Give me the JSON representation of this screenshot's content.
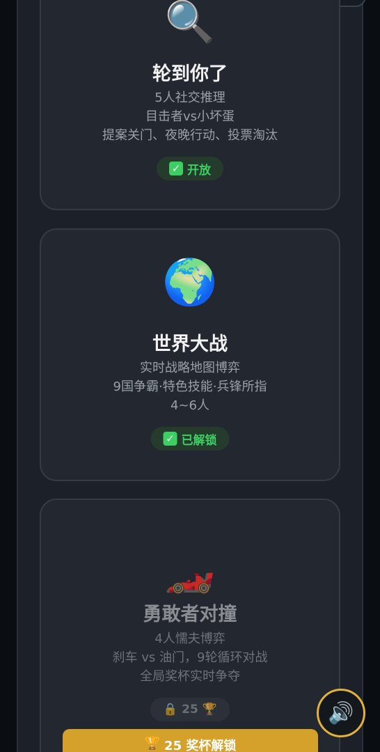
{
  "cards": [
    {
      "icon": "🔍",
      "icon_name": "magnifier-icon",
      "title": "轮到你了",
      "lines": [
        "5人社交推理",
        "目击者vs小坏蛋",
        "提案关门、夜晚行动、投票淘汰"
      ],
      "badge": "开放"
    },
    {
      "icon": "🌍",
      "icon_name": "globe-icon",
      "title": "世界大战",
      "lines": [
        "实时战略地图博弈",
        "9国争霸·特色技能·兵锋所指",
        "4~6人"
      ],
      "badge": "已解锁"
    },
    {
      "icon": "🏎️",
      "icon_name": "race-car-icon",
      "title": "勇敢者对撞",
      "lines": [
        "4人懦夫博弈",
        "刹车 vs 油门，9轮循环对战",
        "全局奖杯实时争夺"
      ],
      "badge_lock": "🔒",
      "badge_count": "25",
      "badge_trophy": "🏆"
    }
  ],
  "unlock_button": {
    "icon": "🏆",
    "label": "25 奖杯解锁"
  },
  "sound_button": {
    "icon": "🔊"
  },
  "colors": {
    "accent_gold": "#d6a12a",
    "status_green": "#3ecf63"
  }
}
